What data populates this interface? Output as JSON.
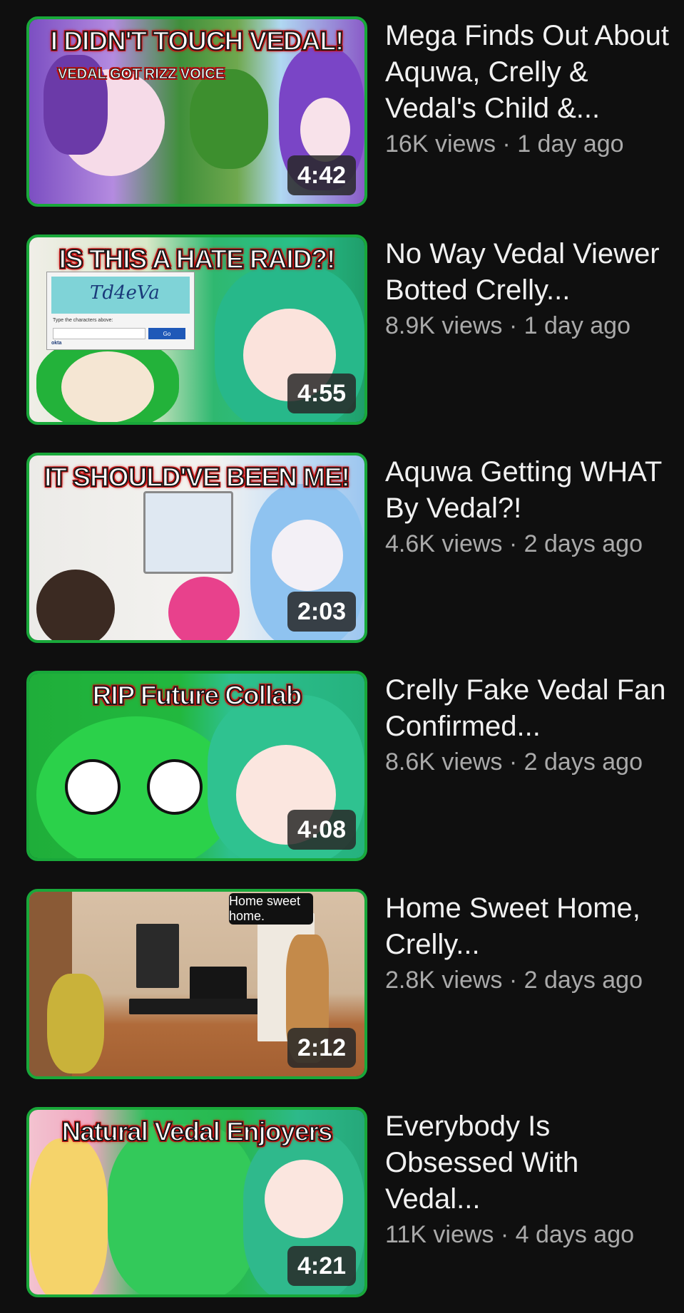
{
  "colors": {
    "background": "#0f0f0f",
    "title_text": "#f1f1f1",
    "stats_text": "#aaaaaa",
    "thumbnail_border": "#19a83a",
    "headline_outline": "#d01515"
  },
  "videos": [
    {
      "title": "Mega Finds Out About Aquwa, Crelly & Vedal's Child &...",
      "views": "16K views",
      "separator": "·",
      "age": "1 day ago",
      "duration": "4:42",
      "thumbnail_headline": "I DIDN'T TOUCH VEDAL!",
      "thumbnail_subtext": "VEDAL GOT RIZZ VOICE"
    },
    {
      "title": "No Way Vedal Viewer Botted Crelly...",
      "views": "8.9K views",
      "separator": "·",
      "age": "1 day ago",
      "duration": "4:55",
      "thumbnail_headline": "IS THIS A HATE RAID?!",
      "captcha": {
        "text": "Td4eVa",
        "label": "Type the characters above:",
        "button": "Go",
        "brand": "okta"
      }
    },
    {
      "title": "Aquwa Getting WHAT By Vedal?!",
      "views": "4.6K views",
      "separator": "·",
      "age": "2 days ago",
      "duration": "2:03",
      "thumbnail_headline": "IT SHOULD'VE BEEN ME!"
    },
    {
      "title": "Crelly Fake Vedal Fan Confirmed...",
      "views": "8.6K views",
      "separator": "·",
      "age": "2 days ago",
      "duration": "4:08",
      "thumbnail_headline": "RIP Future Collab"
    },
    {
      "title": "Home Sweet Home, Crelly...",
      "views": "2.8K views",
      "separator": "·",
      "age": "2 days ago",
      "duration": "2:12",
      "thumbnail_bubble": "Home sweet home."
    },
    {
      "title": "Everybody Is Obsessed With Vedal...",
      "views": "11K views",
      "separator": "·",
      "age": "4 days ago",
      "duration": "4:21",
      "thumbnail_headline": "Natural Vedal Enjoyers"
    }
  ]
}
